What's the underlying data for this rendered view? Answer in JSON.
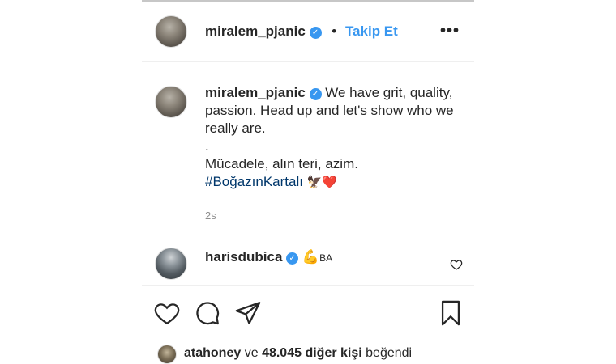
{
  "header": {
    "username": "miralem_pjanic",
    "separator": "•",
    "follow_label": "Takip Et",
    "more_label": "•••"
  },
  "caption": {
    "username": "miralem_pjanic",
    "line1": "We have grit, quality,",
    "line2": "passion. Head up and let's show who we",
    "line3": "really are.",
    "line4": ".",
    "line5": "Mücadele, alın teri, azim.",
    "hashtag": "#BoğazınKartalı",
    "emojis": "🦅❤️",
    "timestamp": "2s"
  },
  "comment": {
    "username": "harisdubica",
    "emoji": "💪",
    "text": "BA"
  },
  "likes": {
    "user": "atahoney",
    "connector": "ve",
    "count_text": "48.045 diğer kişi",
    "suffix": "beğendi"
  },
  "icons": {
    "like": "heart-outline-icon",
    "comment": "comment-bubble-icon",
    "share": "paper-plane-icon",
    "save": "bookmark-icon",
    "verified": "verified-badge-icon"
  },
  "colors": {
    "link_blue": "#3897f0",
    "hashtag_blue": "#00376b",
    "text": "#262626",
    "muted": "#8e8e8e",
    "heart_red": "#ed4956"
  }
}
